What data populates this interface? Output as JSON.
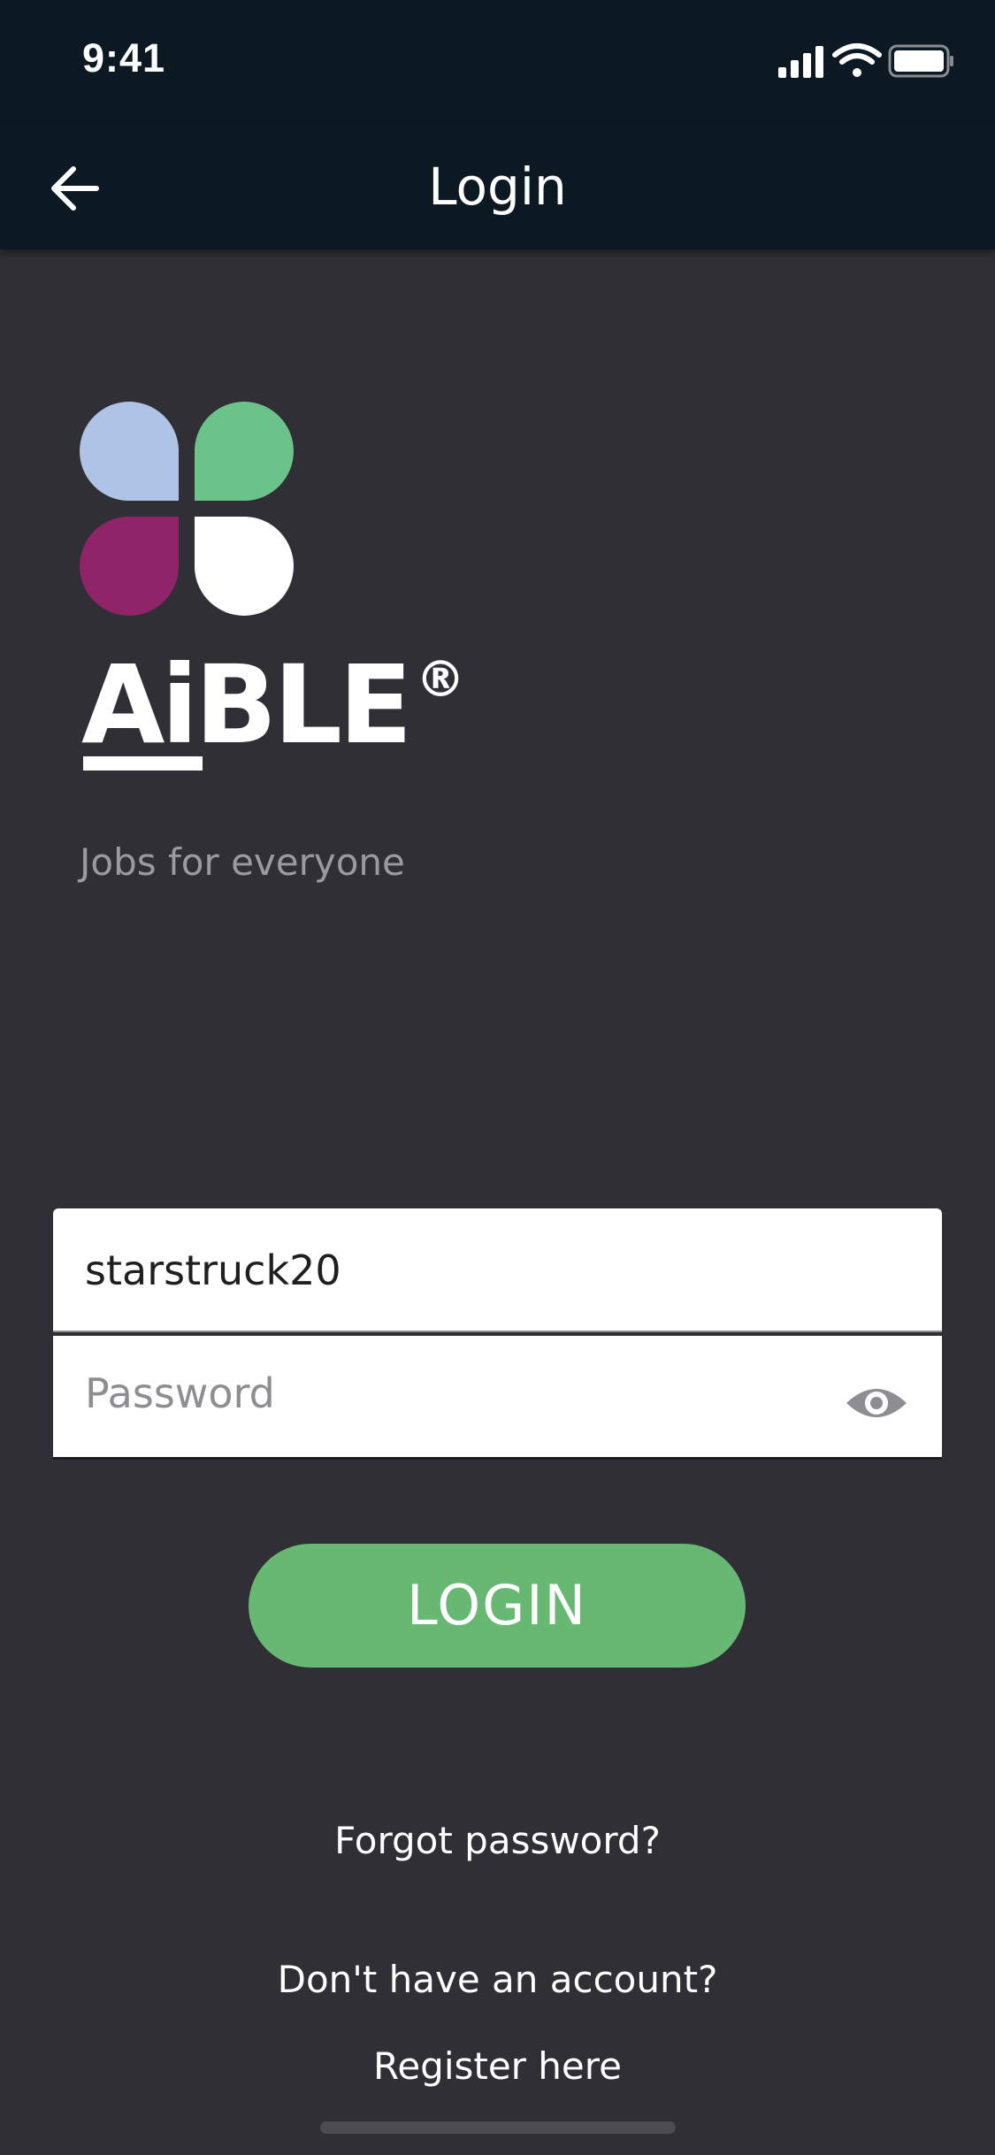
{
  "status_bar": {
    "time": "9:41",
    "icons": [
      "signal-icon",
      "wifi-icon",
      "battery-icon"
    ]
  },
  "header": {
    "title": "Login",
    "back_icon": "arrow-left-icon"
  },
  "brand": {
    "name": "AiBLE",
    "registered_mark": "®",
    "tagline": "Jobs for everyone",
    "logo_colors": [
      "#aec3e6",
      "#6cc389",
      "#8f2468",
      "#ffffff"
    ]
  },
  "form": {
    "username_value": "starstruck20",
    "password_placeholder": "Password",
    "password_toggle_icon": "eye-icon",
    "login_label": "LOGIN"
  },
  "links": {
    "forgot_password": "Forgot password?",
    "no_account": "Don't have an account?",
    "register": "Register here"
  },
  "colors": {
    "background": "#302f35",
    "header": "#0c1822",
    "accent_green": "#67b872"
  }
}
